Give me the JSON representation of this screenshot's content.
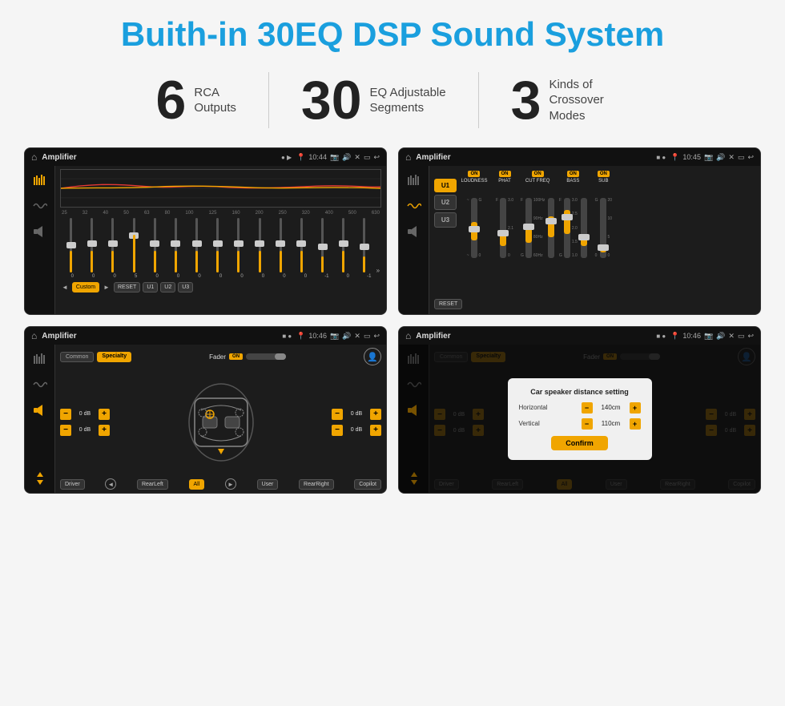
{
  "page": {
    "title": "Buith-in 30EQ DSP Sound System",
    "stats": [
      {
        "number": "6",
        "label": "RCA\nOutputs"
      },
      {
        "number": "30",
        "label": "EQ Adjustable\nSegments"
      },
      {
        "number": "3",
        "label": "Kinds of\nCrossover Modes"
      }
    ]
  },
  "screens": {
    "eq": {
      "title": "Amplifier",
      "time": "10:44",
      "freqs": [
        "25",
        "32",
        "40",
        "50",
        "63",
        "80",
        "100",
        "125",
        "160",
        "200",
        "250",
        "320",
        "400",
        "500",
        "630"
      ],
      "values": [
        "0",
        "0",
        "0",
        "5",
        "0",
        "0",
        "0",
        "0",
        "0",
        "0",
        "0",
        "0",
        "-1",
        "0",
        "-1"
      ],
      "buttons": [
        "Custom",
        "RESET",
        "U1",
        "U2",
        "U3"
      ]
    },
    "crossover": {
      "title": "Amplifier",
      "time": "10:45",
      "presets": [
        "U1",
        "U2",
        "U3"
      ],
      "channels": [
        {
          "name": "LOUDNESS",
          "on": true
        },
        {
          "name": "PHAT",
          "on": true
        },
        {
          "name": "CUT FREQ",
          "on": true
        },
        {
          "name": "BASS",
          "on": true
        },
        {
          "name": "SUB",
          "on": true
        }
      ],
      "reset_label": "RESET"
    },
    "fader": {
      "title": "Amplifier",
      "time": "10:46",
      "tabs": [
        "Common",
        "Specialty"
      ],
      "fader_label": "Fader",
      "fader_on": "ON",
      "controls": {
        "fl": "0 dB",
        "fr": "0 dB",
        "rl": "0 dB",
        "rr": "0 dB"
      },
      "bottom_btns": [
        "Driver",
        "RearLeft",
        "All",
        "User",
        "RearRight",
        "Copilot"
      ]
    },
    "distance": {
      "title": "Amplifier",
      "time": "10:46",
      "tabs": [
        "Common",
        "Specialty"
      ],
      "fader_label": "Fader",
      "fader_on": "ON",
      "modal": {
        "title": "Car speaker distance setting",
        "horizontal_label": "Horizontal",
        "horizontal_value": "140cm",
        "vertical_label": "Vertical",
        "vertical_value": "110cm",
        "confirm_label": "Confirm"
      },
      "controls": {
        "fl": "0 dB",
        "fr": "0 dB"
      },
      "bottom_btns": [
        "Driver",
        "RearLeft",
        "All",
        "User",
        "RearRight",
        "Copilot"
      ]
    }
  }
}
